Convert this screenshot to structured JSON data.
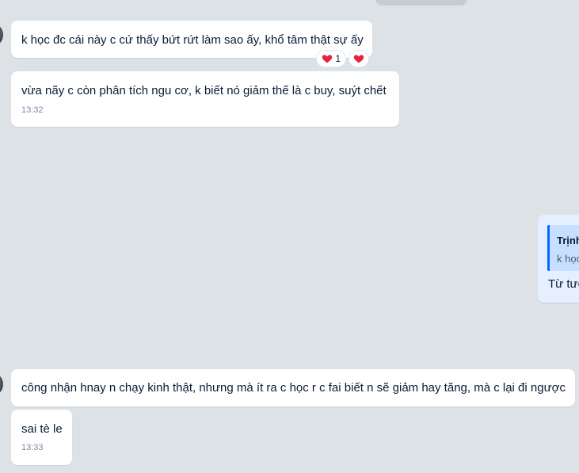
{
  "messages": [
    {
      "text": "k học đc cái này c cứ thấy bứt rứt làm sao ấy, khổ tâm thật sự ấy",
      "reactions": [
        {
          "icon": "heart-icon",
          "count": "1"
        },
        {
          "icon": "heart-icon"
        }
      ]
    },
    {
      "text": "vừa nãy c còn phân tích ngu cơ, k biết nó giảm thế là c buy, suýt chết",
      "time": "13:32"
    },
    {
      "text": "công nhận hnay n chạy kinh thật, nhưng mà ít ra c học r c fai biết n sẽ giảm hay tăng, mà c lại đi ngược"
    },
    {
      "text": "sai tè le",
      "time": "13:33"
    }
  ],
  "sent_message": {
    "quote_name": "Trịnh",
    "quote_text": "k học",
    "text": "Từ tươ"
  },
  "colors": {
    "background": "#dde2e7",
    "bubble_received": "#ffffff",
    "bubble_sent": "#e5efff",
    "quote_bar": "#0068ff",
    "heart": "#e5243b"
  }
}
